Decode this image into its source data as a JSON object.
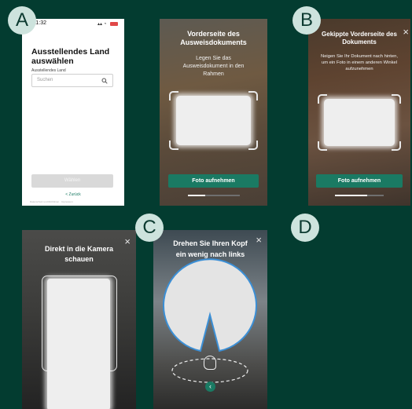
{
  "badges": [
    "A",
    "B",
    "C",
    "D"
  ],
  "screen_a": {
    "status_time": "11:32",
    "title": "Ausstellendes Land auswählen",
    "field_label": "Ausstellendes Land",
    "search_placeholder": "Suchen",
    "primary_button": "Wählen",
    "back_link": "< Zurück",
    "footer": "Datenschutz und Richtlinien · Impressum"
  },
  "screen_front": {
    "title": "Vorderseite des Ausweisdokuments",
    "subtitle": "Legen Sie das Ausweisdokument in den Rahmen",
    "button": "Foto aufnehmen",
    "progress": 0.33
  },
  "screen_tilted": {
    "title": "Gekippte Vorderseite des Dokuments",
    "subtitle": "Neigen Sie Ihr Dokument nach hinten, um ein Foto in einem anderen Winkel aufzunehmen",
    "button": "Foto aufnehmen",
    "progress": 0.66
  },
  "screen_face": {
    "title": "Direkt in die Kamera schauen"
  },
  "screen_turn": {
    "title": "Drehen Sie Ihren Kopf ein wenig nach links"
  },
  "colors": {
    "background": "#033c30",
    "accent": "#1a7a63",
    "badge": "#cde3dd",
    "guide": "#3b8fd6"
  },
  "icons": [
    "close-icon",
    "search-icon",
    "head-turn-icon",
    "chevron-left-icon",
    "wifi-icon",
    "battery-icon"
  ]
}
